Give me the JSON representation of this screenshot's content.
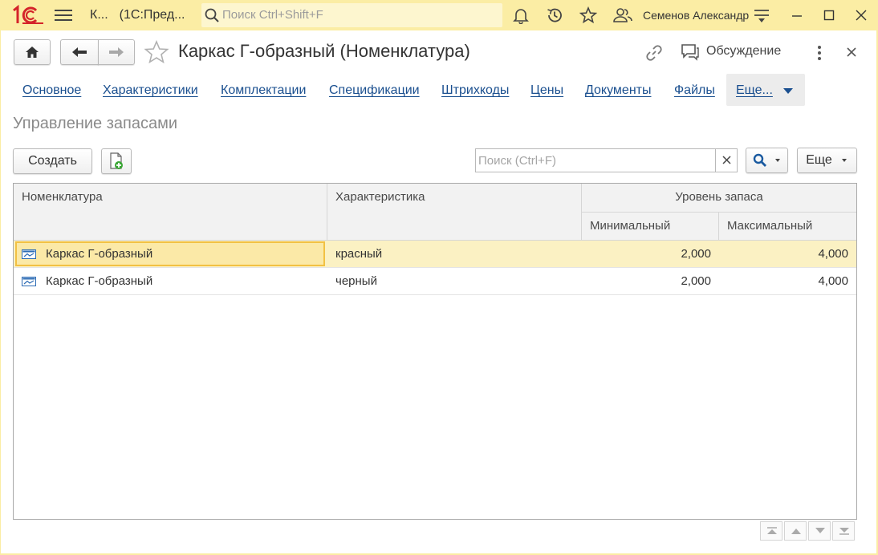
{
  "app": {
    "window_title_short": "К...",
    "window_title_app": "(1С:Пред...",
    "global_search_placeholder": "Поиск Ctrl+Shift+F",
    "user_name": "Семенов Александр"
  },
  "form": {
    "title": "Каркас Г-образный (Номенклатура)",
    "discussion_label": "Обсуждение",
    "tabs": [
      {
        "label": "Основное"
      },
      {
        "label": "Характеристики"
      },
      {
        "label": "Комплектации"
      },
      {
        "label": "Спецификации"
      },
      {
        "label": "Штрихкоды"
      },
      {
        "label": "Цены"
      },
      {
        "label": "Документы"
      },
      {
        "label": "Файлы"
      }
    ],
    "more_tab_label": "Еще..."
  },
  "section": {
    "title": "Управление запасами",
    "create_label": "Создать",
    "search_placeholder": "Поиск (Ctrl+F)",
    "more_label": "Еще"
  },
  "grid": {
    "columns": {
      "nomenclature": "Номенклатура",
      "characteristic": "Характеристика",
      "stock_level": "Уровень запаса",
      "min": "Минимальный",
      "max": "Максимальный"
    },
    "rows": [
      {
        "nomenclature": "Каркас Г-образный",
        "characteristic": "красный",
        "min": "2,000",
        "max": "4,000",
        "selected": true
      },
      {
        "nomenclature": "Каркас Г-образный",
        "characteristic": "черный",
        "min": "2,000",
        "max": "4,000",
        "selected": false
      }
    ]
  },
  "colors": {
    "chrome": "#fbeda4",
    "link": "#1a4f8f",
    "selected_row": "#fbf1c3",
    "focus_border": "#f2c144",
    "logo_red": "#d4242a"
  }
}
